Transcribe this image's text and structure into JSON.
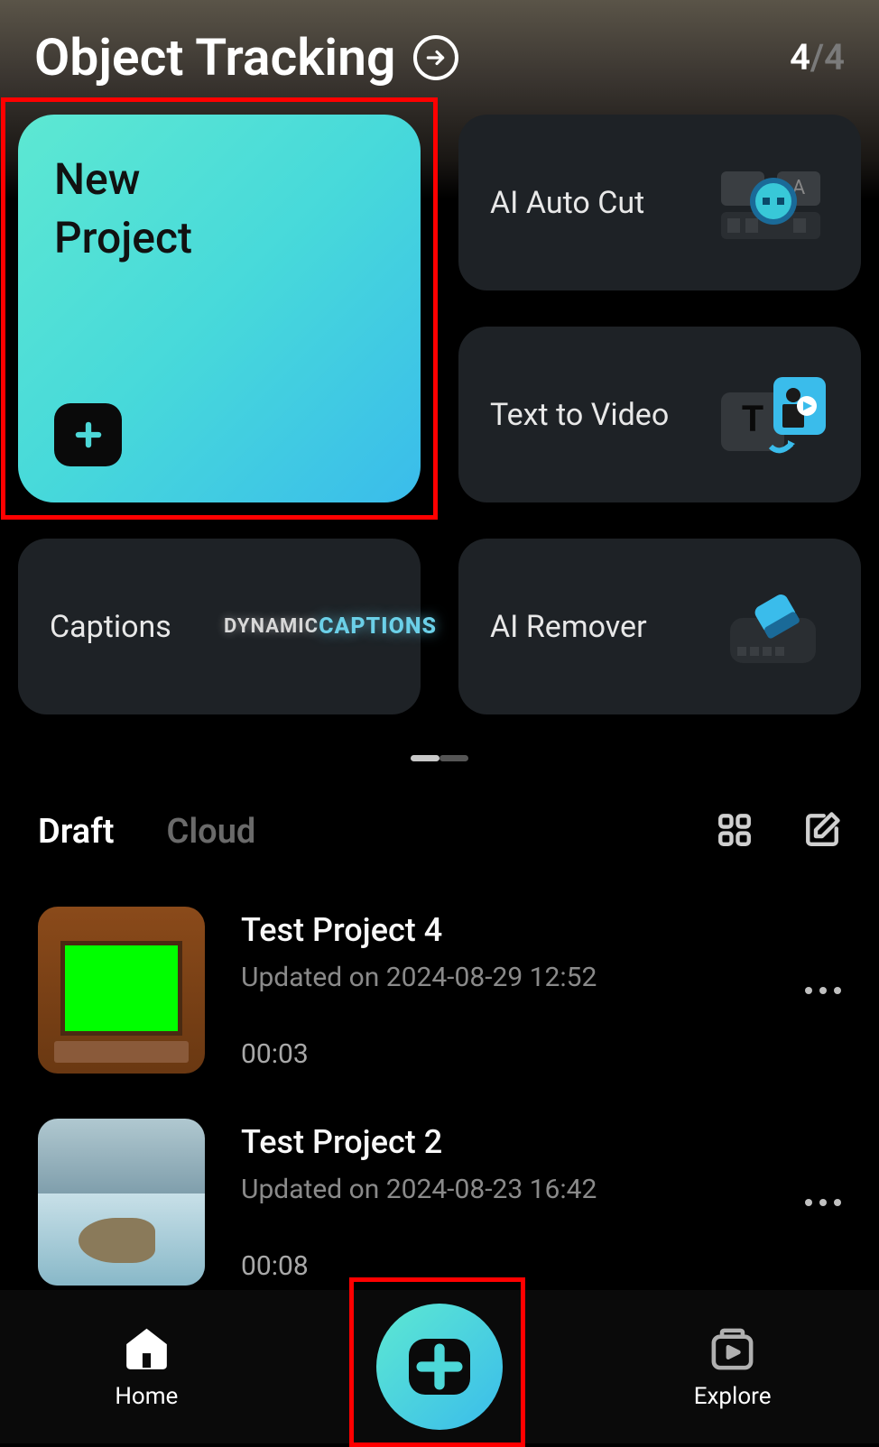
{
  "header": {
    "title": "Object Tracking",
    "page_current": "4",
    "page_total": "4"
  },
  "features": {
    "new_project_label": "New\nProject",
    "ai_auto_cut_label": "AI Auto Cut",
    "text_to_video_label": "Text to Video",
    "captions_label": "Captions",
    "ai_remover_label": "AI Remover",
    "captions_deco_1": "DYNAMIC",
    "captions_deco_2": "CAPTIONS"
  },
  "tabs": {
    "draft": "Draft",
    "cloud": "Cloud"
  },
  "drafts": [
    {
      "title": "Test Project 4",
      "updated": "Updated on 2024-08-29 12:52",
      "duration": "00:03"
    },
    {
      "title": "Test Project 2",
      "updated": "Updated on 2024-08-23 16:42",
      "duration": "00:08"
    }
  ],
  "nav": {
    "home": "Home",
    "explore": "Explore"
  }
}
